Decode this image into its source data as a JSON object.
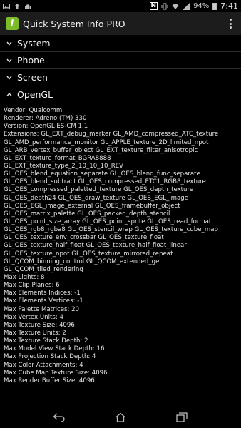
{
  "status_bar": {
    "battery": "94%",
    "time": "7:41",
    "nfc_letter": "N"
  },
  "app": {
    "title": "Quick System Info PRO",
    "icon_letter": "i"
  },
  "sections": {
    "system": "System",
    "phone": "Phone",
    "screen": "Screen",
    "opengl": "OpenGL"
  },
  "opengl": {
    "lines": [
      "Vendor: Qualcomm",
      "Renderer: Adreno (TM) 330",
      "Version: OpenGL ES-CM 1.1",
      "Extensions: GL_EXT_debug_marker GL_AMD_compressed_ATC_texture",
      "GL_AMD_performance_monitor GL_APPLE_texture_2D_limited_npot",
      "GL_ARB_vertex_buffer_object GL_EXT_texture_filter_anisotropic",
      "GL_EXT_texture_format_BGRA8888",
      "GL_EXT_texture_type_2_10_10_10_REV",
      "GL_OES_blend_equation_separate GL_OES_blend_func_separate",
      "GL_OES_blend_subtract GL_OES_compressed_ETC1_RGB8_texture",
      "GL_OES_compressed_paletted_texture GL_OES_depth_texture",
      "GL_OES_depth24 GL_OES_draw_texture GL_OES_EGL_image",
      "GL_OES_EGL_image_external GL_OES_framebuffer_object",
      "GL_OES_matrix_palette GL_OES_packed_depth_stencil",
      "GL_OES_point_size_array GL_OES_point_sprite GL_OES_read_format",
      "GL_OES_rgb8_rgba8 GL_OES_stencil_wrap GL_OES_texture_cube_map",
      "GL_OES_texture_env_crossbar GL_OES_texture_float",
      "GL_OES_texture_half_float GL_OES_texture_half_float_linear",
      "GL_OES_texture_npot GL_OES_texture_mirrored_repeat",
      "GL_QCOM_binning_control GL_QCOM_extended_get",
      "GL_QCOM_tiled_rendering",
      "Max Lights: 8",
      "Max Clip Planes: 6",
      "Max Elements Indices: -1",
      "Max Elements Vertices: -1",
      "Max Palette Matrices: 20",
      "Max Vertex Units: 4",
      "Max Texture Size: 4096",
      "Max Texture Units: 2",
      "Max Texture Stack Depth: 2",
      "Max Model View Stack Depth: 16",
      "Max Projection Stack Depth: 4",
      "Max Color Attachments: 4",
      "Max Cube Map Texture Size: 4096",
      "Max Render Buffer Size: 4096"
    ]
  },
  "colors": {
    "app_icon": "#7dbb2b",
    "actionbar": "#1c1c1c",
    "background": "#000000"
  }
}
